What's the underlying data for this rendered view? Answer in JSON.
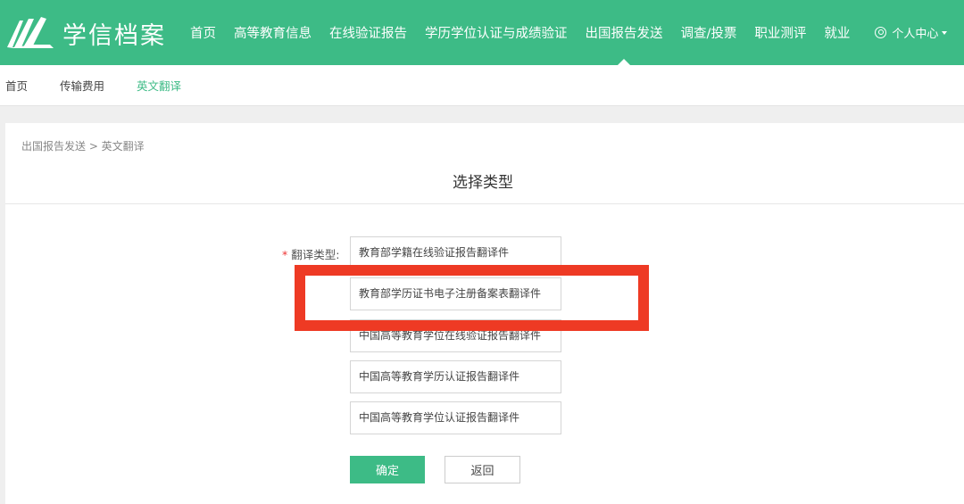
{
  "header": {
    "logo_text": "学信档案",
    "nav": [
      {
        "label": "首页"
      },
      {
        "label": "高等教育信息"
      },
      {
        "label": "在线验证报告"
      },
      {
        "label": "学历学位认证与成绩验证"
      },
      {
        "label": "出国报告发送"
      },
      {
        "label": "调查/投票"
      },
      {
        "label": "职业测评"
      },
      {
        "label": "就业"
      }
    ],
    "active_nav": "出国报告发送",
    "user_center": "个人中心"
  },
  "subnav": {
    "items": [
      {
        "label": "首页"
      },
      {
        "label": "传输费用"
      },
      {
        "label": "英文翻译"
      }
    ],
    "active": "英文翻译"
  },
  "breadcrumb": "出国报告发送 > 英文翻译",
  "title": "选择类型",
  "form": {
    "required_mark": "*",
    "label": "翻译类型:",
    "options": [
      {
        "label": "教育部学籍在线验证报告翻译件"
      },
      {
        "label": "教育部学历证书电子注册备案表翻译件"
      },
      {
        "label": "中国高等教育学位在线验证报告翻译件"
      },
      {
        "label": "中国高等教育学历认证报告翻译件"
      },
      {
        "label": "中国高等教育学位认证报告翻译件"
      }
    ],
    "highlighted_option": "教育部学历证书电子注册备案表翻译件"
  },
  "buttons": {
    "confirm": "确定",
    "back": "返回"
  },
  "colors": {
    "brand_green": "#3dbb86",
    "highlight_red": "#ee3a24"
  }
}
